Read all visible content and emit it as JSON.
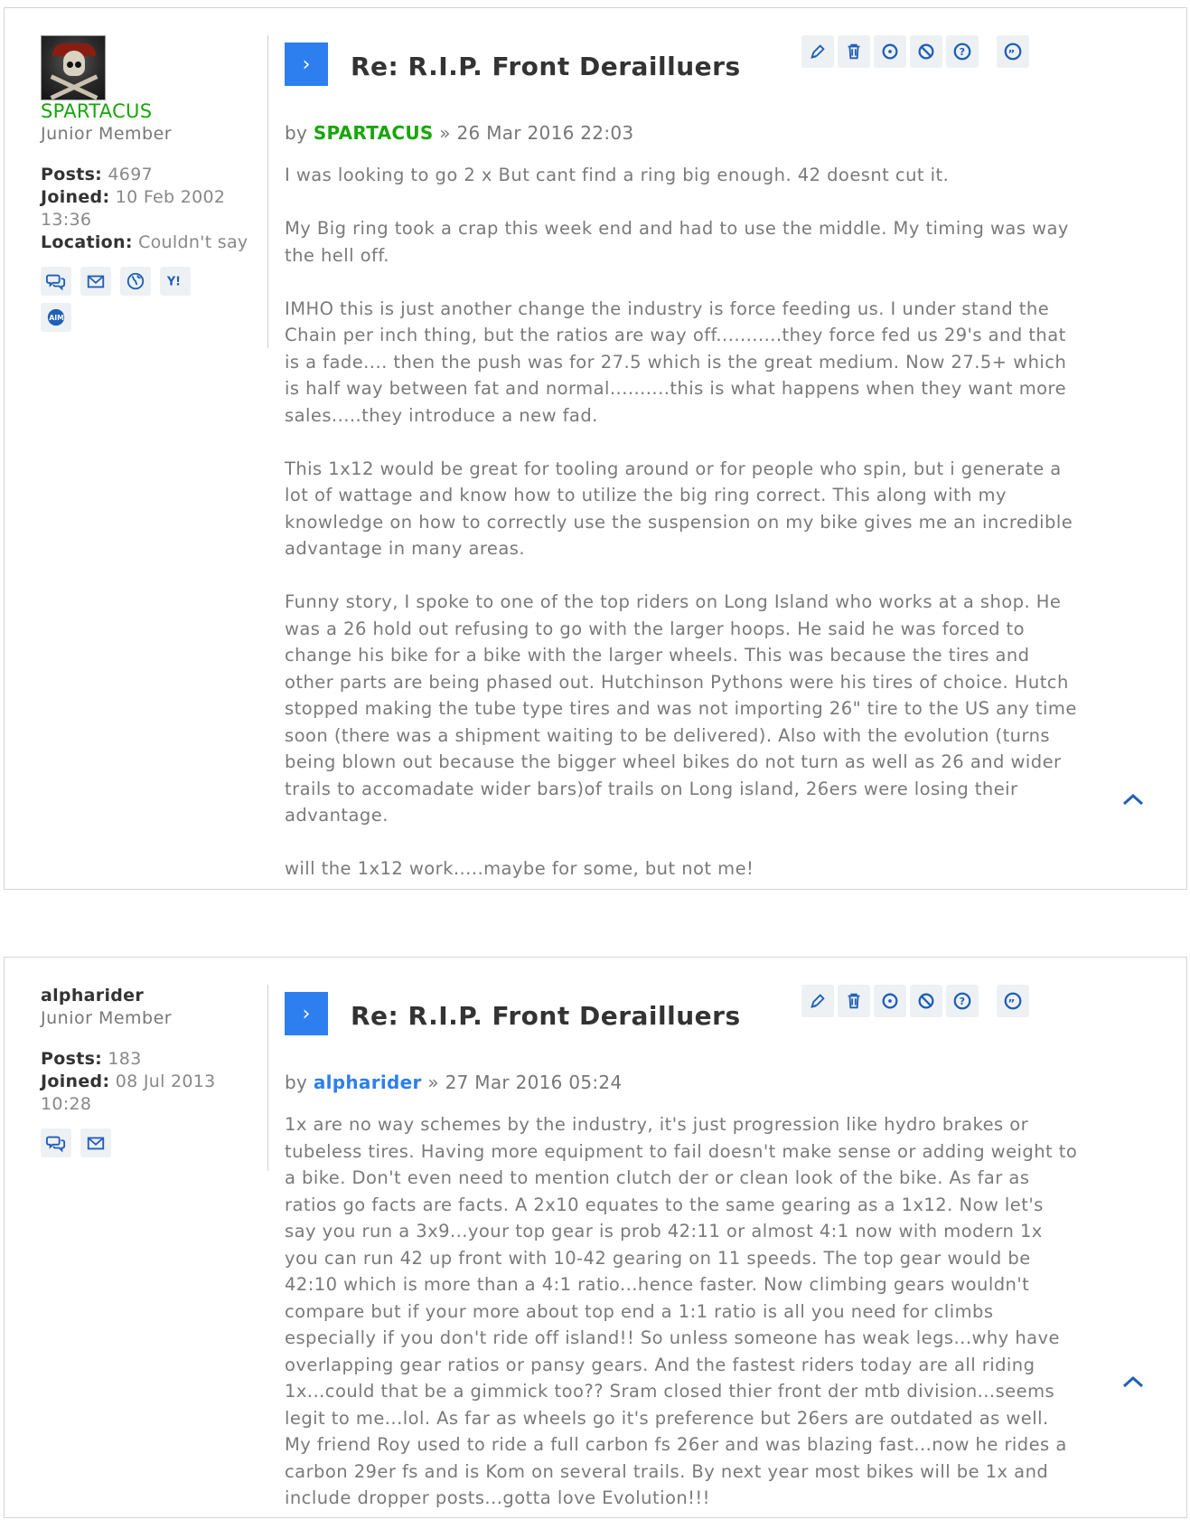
{
  "colors": {
    "accent": "#2d7ff0",
    "green_user": "#18a60a",
    "button_bg": "#eef1f4",
    "border": "#d4d4d4"
  },
  "posts": [
    {
      "username": "SPARTACUS",
      "rank": "Junior Member",
      "posts_label": "Posts:",
      "posts_value": "4697",
      "joined_label": "Joined:",
      "joined_value": "10 Feb 2002 13:36",
      "location_label": "Location:",
      "location_value": "Couldn't say",
      "contact_icons": [
        "pm-icon",
        "email-icon",
        "website-icon",
        "yahoo-icon",
        "aim-icon"
      ],
      "title": "Re: R.I.P. Front Derailluers",
      "by": "by",
      "sep": "»",
      "date": "26 Mar 2016 22:03",
      "paragraphs": [
        "I was looking to go 2 x But cant find a ring big enough. 42 doesnt cut it.",
        "My Big ring took a crap this week end and had to use the middle. My timing was way the hell off.",
        "IMHO this is just another change the industry is force feeding us. I under stand the Chain per inch thing, but the ratios are way off...........they force fed us 29's and that is a fade.... then the push was for 27.5 which is the great medium. Now 27.5+ which is half way between fat and normal..........this is what happens when they want more sales.....they introduce a new fad.",
        "This 1x12 would be great for tooling around or for people who spin, but i generate a lot of wattage and know how to utilize the big ring correct. This along with my knowledge on how to correctly use the suspension on my bike gives me an incredible advantage in many areas.",
        "Funny story, I spoke to one of the top riders on Long Island who works at a shop. He was a 26 hold out refusing to go with the larger hoops. He said he was forced to change his bike for a bike with the larger wheels. This was because the tires and other parts are being phased out. Hutchinson Pythons were his tires of choice. Hutch stopped making the tube type tires and was not importing 26\" tire to the US any time soon (there was a shipment waiting to be delivered). Also with the evolution (turns being blown out because the bigger wheel bikes do not turn as well as 26 and wider trails to accomadate wider bars)of trails on Long island, 26ers were losing their advantage.",
        "will the 1x12 work.....maybe for some, but not me!"
      ]
    },
    {
      "username": "alpharider",
      "rank": "Junior Member",
      "posts_label": "Posts:",
      "posts_value": "183",
      "joined_label": "Joined:",
      "joined_value": "08 Jul 2013 10:28",
      "contact_icons": [
        "pm-icon",
        "email-icon"
      ],
      "title": "Re: R.I.P. Front Derailluers",
      "by": "by",
      "sep": "»",
      "date": "27 Mar 2016 05:24",
      "paragraphs": [
        "1x are no way schemes by the industry, it's just progression like hydro brakes or tubeless tires. Having more equipment to fail doesn't make sense or adding weight to a bike. Don't even need to mention clutch der or clean look of the bike. As far as ratios go facts are facts. A 2x10 equates to the same gearing as a 1x12. Now let's say you run a 3x9...your top gear is prob 42:11 or almost 4:1 now with modern 1x you can run 42 up front with 10-42 gearing on 11 speeds. The top gear would be 42:10 which is more than a 4:1 ratio...hence faster. Now climbing gears wouldn't compare but if your more about top end a 1:1 ratio is all you need for climbs especially if you don't ride off island!! So unless someone has weak legs...why have overlapping gear ratios or pansy gears. And the fastest riders today are all riding 1x...could that be a gimmick too?? Sram closed thier front der mtb division...seems legit to me...lol. As far as wheels go it's preference but 26ers are outdated as well. My friend Roy used to ride a full carbon fs 26er and was blazing fast...now he rides a carbon 29er fs and is Kom on several trails. By next year most bikes will be 1x and include dropper posts...gotta love Evolution!!!"
      ]
    }
  ],
  "action_icons": [
    "edit-icon",
    "delete-icon",
    "report-icon",
    "warn-icon",
    "info-icon",
    "quote-icon"
  ],
  "arrow_glyph": "›"
}
